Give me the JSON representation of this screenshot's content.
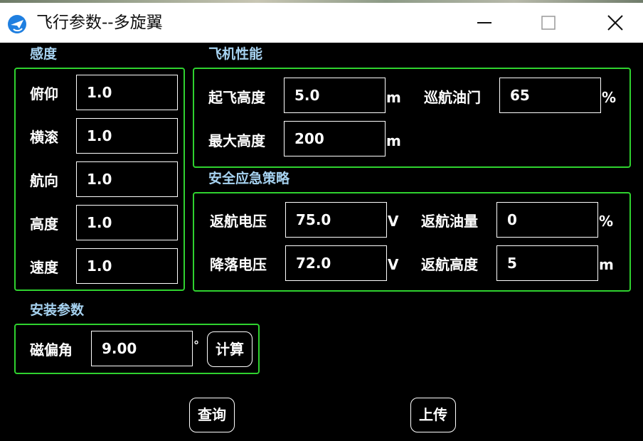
{
  "window": {
    "title": "飞行参数--多旋翼"
  },
  "sensitivity": {
    "title": "感度",
    "rows": [
      {
        "label": "俯仰",
        "value": "1.0"
      },
      {
        "label": "横滚",
        "value": "1.0"
      },
      {
        "label": "航向",
        "value": "1.0"
      },
      {
        "label": "高度",
        "value": "1.0"
      },
      {
        "label": "速度",
        "value": "1.0"
      }
    ]
  },
  "performance": {
    "title": "飞机性能",
    "takeoff_label": "起飞高度",
    "takeoff_value": "5.0",
    "takeoff_unit": "m",
    "cruise_label": "巡航油门",
    "cruise_value": "65",
    "cruise_unit": "%",
    "maxalt_label": "最大高度",
    "maxalt_value": "200",
    "maxalt_unit": "m"
  },
  "safety": {
    "title": "安全应急策略",
    "rtl_voltage_label": "返航电压",
    "rtl_voltage_value": "75.0",
    "rtl_voltage_unit": "V",
    "rtl_fuel_label": "返航油量",
    "rtl_fuel_value": "0",
    "rtl_fuel_unit": "%",
    "land_voltage_label": "降落电压",
    "land_voltage_value": "72.0",
    "land_voltage_unit": "V",
    "rtl_alt_label": "返航高度",
    "rtl_alt_value": "5",
    "rtl_alt_unit": "m"
  },
  "install": {
    "title": "安装参数",
    "mag_label": "磁偏角",
    "mag_value": "9.00",
    "mag_unit": "°",
    "calc_label": "计算"
  },
  "actions": {
    "query_label": "查询",
    "upload_label": "上传"
  },
  "colors": {
    "group_border": "#2fd22f",
    "section_title": "#a6d2f0",
    "background": "#000000"
  }
}
